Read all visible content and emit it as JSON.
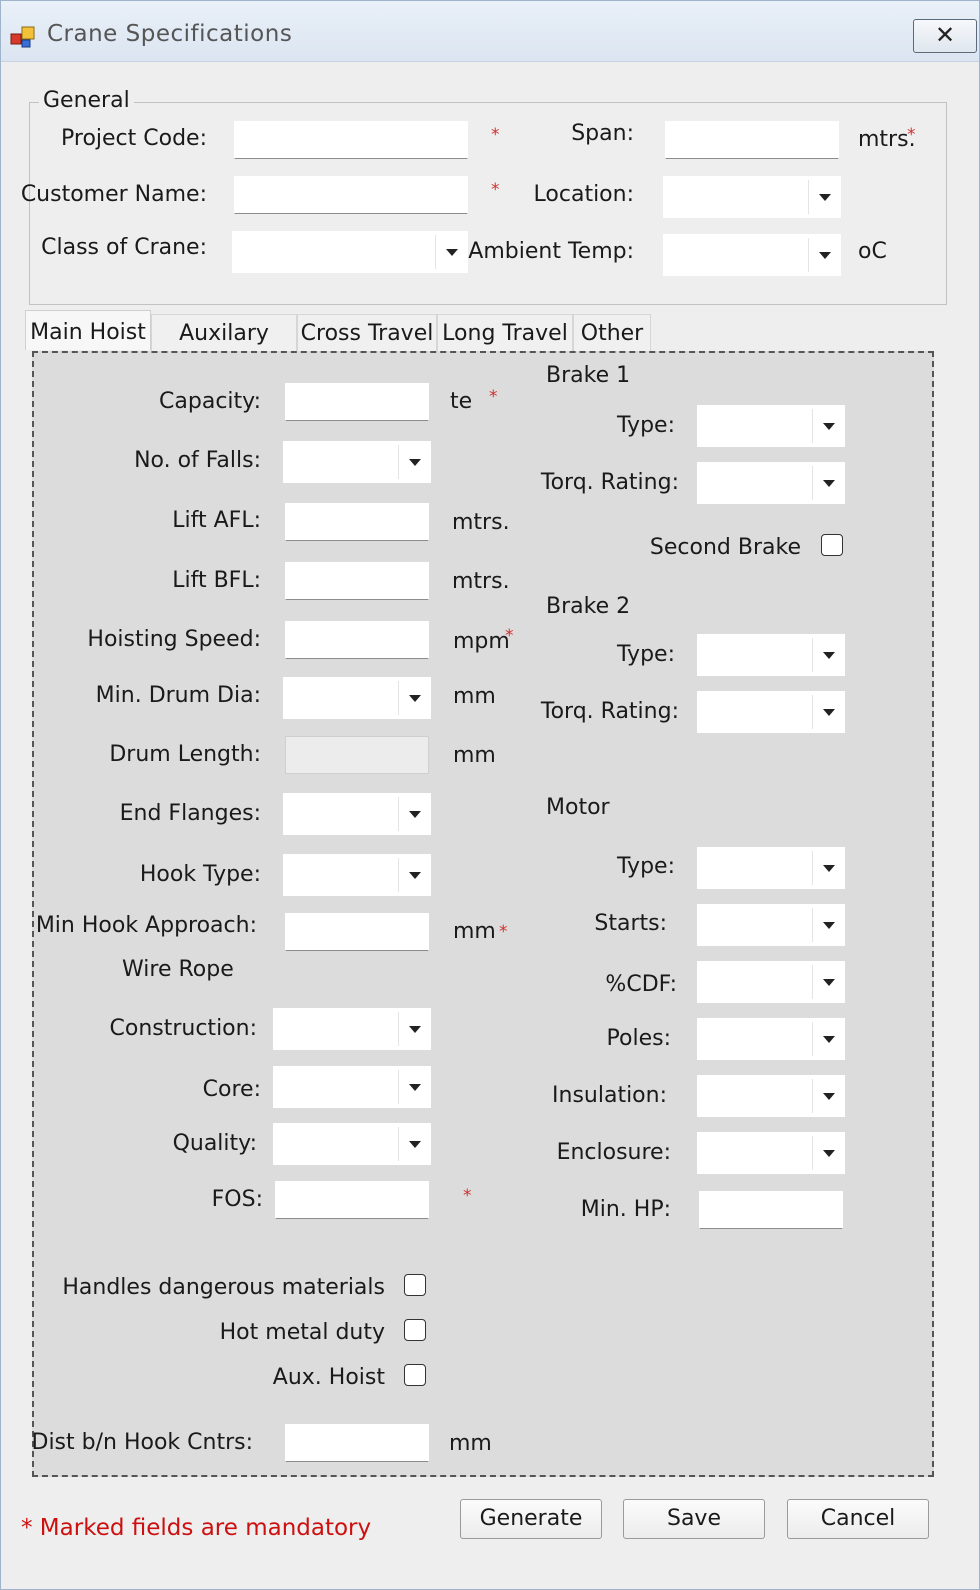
{
  "window": {
    "title": "Crane Specifications",
    "close_glyph": "✕"
  },
  "general": {
    "legend": "General",
    "project_code_label": "Project Code:",
    "customer_name_label": "Customer Name:",
    "class_of_crane_label": "Class of Crane:",
    "span_label": "Span:",
    "span_unit": "mtrs.",
    "location_label": "Location:",
    "ambient_temp_label": "Ambient Temp:",
    "ambient_temp_unit": "oC",
    "project_code_value": "",
    "customer_name_value": "",
    "span_value": ""
  },
  "tabs": [
    "Main Hoist",
    "Auxilary Hoist",
    "Cross Travel",
    "Long Travel",
    "Other"
  ],
  "main_hoist": {
    "capacity_label": "Capacity:",
    "capacity_unit": "te",
    "falls_label": "No. of Falls:",
    "lift_afl_label": "Lift AFL:",
    "lift_afl_unit": "mtrs.",
    "lift_bfl_label": "Lift BFL:",
    "lift_bfl_unit": "mtrs.",
    "hoisting_speed_label": "Hoisting Speed:",
    "hoisting_speed_unit": "mpm",
    "drum_dia_label": "Min. Drum Dia:",
    "drum_dia_unit": "mm",
    "drum_length_label": "Drum Length:",
    "drum_length_unit": "mm",
    "end_flanges_label": "End Flanges:",
    "hook_type_label": "Hook Type:",
    "hook_approach_label": "Min Hook Approach:",
    "hook_approach_unit": "mm",
    "wire_rope_heading": "Wire Rope",
    "construction_label": "Construction:",
    "core_label": "Core:",
    "quality_label": "Quality:",
    "fos_label": "FOS:",
    "dangerous_label": "Handles dangerous materials",
    "hot_metal_label": "Hot metal duty",
    "aux_hoist_label": "Aux. Hoist",
    "dist_label": "Dist b/n Hook Cntrs:",
    "dist_unit": "mm",
    "brake1_heading": "Brake 1",
    "brake1_type_label": "Type:",
    "brake1_torq_label": "Torq. Rating:",
    "second_brake_label": "Second Brake",
    "brake2_heading": "Brake 2",
    "brake2_type_label": "Type:",
    "brake2_torq_label": "Torq. Rating:",
    "motor_heading": "Motor",
    "motor_type_label": "Type:",
    "starts_label": "Starts:",
    "cdf_label": "%CDF:",
    "poles_label": "Poles:",
    "insulation_label": "Insulation:",
    "enclosure_label": "Enclosure:",
    "min_hp_label": "Min. HP:"
  },
  "required_mark": "*",
  "footer": {
    "mandatory_note": "* Marked fields are mandatory"
  },
  "buttons": {
    "generate": "Generate",
    "save": "Save",
    "cancel": "Cancel"
  },
  "colors": {
    "required": "#cc1010",
    "panel_bg": "#dcdcdc",
    "titlebar": "#dbe5f1"
  }
}
